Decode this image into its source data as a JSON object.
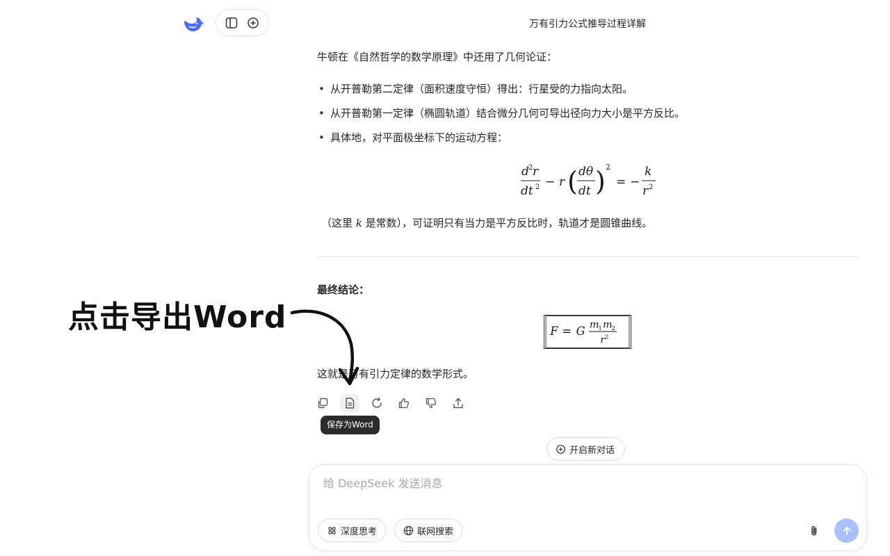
{
  "app": {
    "conversation_title": "万有引力公式推导过程详解",
    "icons": {
      "logo": "deepseek-whale-icon",
      "sidebar_toggle": "sidebar-toggle-icon",
      "new_chat": "new-chat-icon"
    }
  },
  "message": {
    "intro": "牛顿在《自然哲学的数学原理》中还用了几何论证：",
    "bullets": [
      "从开普勒第二定律（面积速度守恒）得出：行星受的力指向太阳。",
      "从开普勒第一定律（椭圆轨道）结合微分几何可导出径向力大小是平方反比。",
      "具体地，对平面极坐标下的运动方程："
    ],
    "note_prefix": "（这里 ",
    "note_var": "k",
    "note_suffix": " 是常数），可证明只有当力是平方反比时，轨道才是圆锥曲线。",
    "conclusion_label": "最终结论：",
    "closing": "这就是万有引力定律的数学形式。"
  },
  "annotation": {
    "text": "点击导出Word"
  },
  "actions": {
    "items": [
      "copy-icon",
      "save-as-word-icon",
      "regenerate-icon",
      "thumbs-up-icon",
      "thumbs-down-icon",
      "share-icon"
    ],
    "tooltip": "保存为Word"
  },
  "new_chat_button": {
    "label": "开启新对话"
  },
  "composer": {
    "placeholder": "给 DeepSeek 发送消息",
    "deep_think_label": "深度思考",
    "web_search_label": "联网搜索"
  },
  "colors": {
    "accent": "#4d6bfe",
    "send_disabled": "#a9c0fb",
    "tooltip_bg": "#2b2b2b"
  }
}
